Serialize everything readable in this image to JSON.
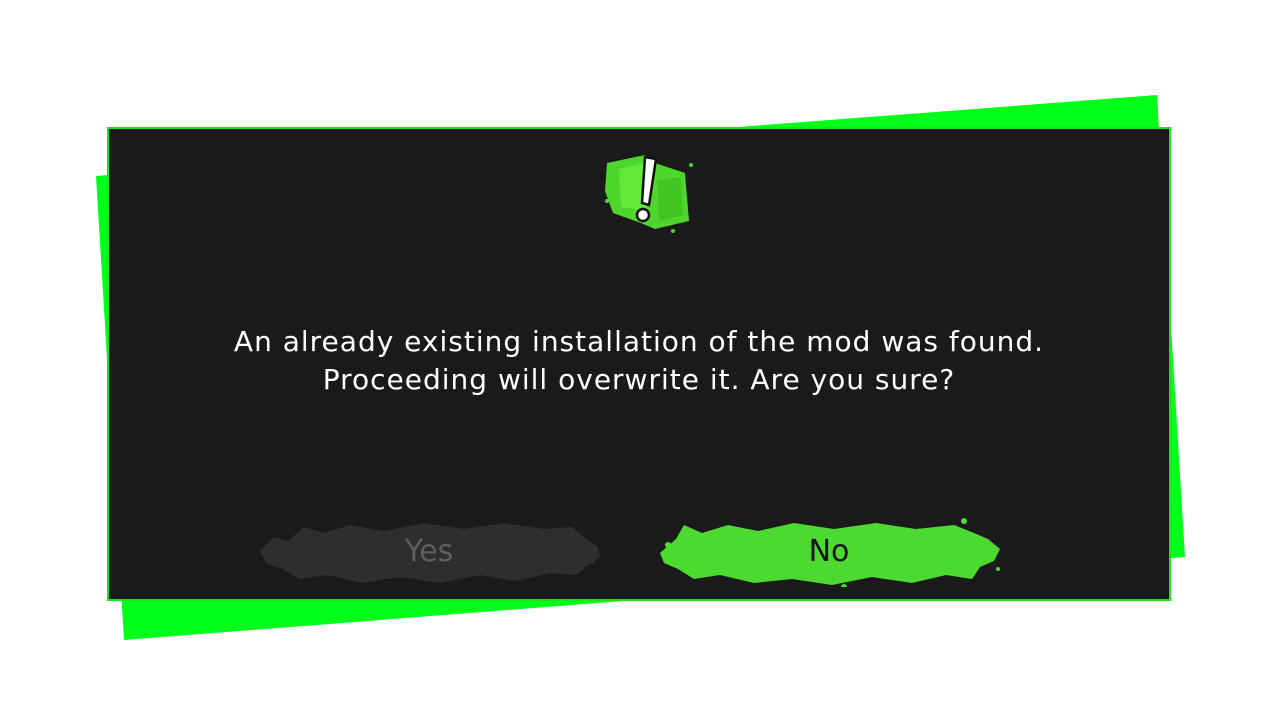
{
  "dialog": {
    "message_line1": "An already existing installation of the mod was found.",
    "message_line2": "Proceeding will overwrite it. Are you sure?",
    "icon": "exclamation-warning-icon"
  },
  "buttons": {
    "yes_label": "Yes",
    "no_label": "No",
    "yes_state": "disabled"
  },
  "colors": {
    "accent_green": "#17ff17",
    "button_green": "#4cd930",
    "panel_bg": "#1a1a1a",
    "disabled_button": "#2e2e2e",
    "text": "#ffffff"
  }
}
